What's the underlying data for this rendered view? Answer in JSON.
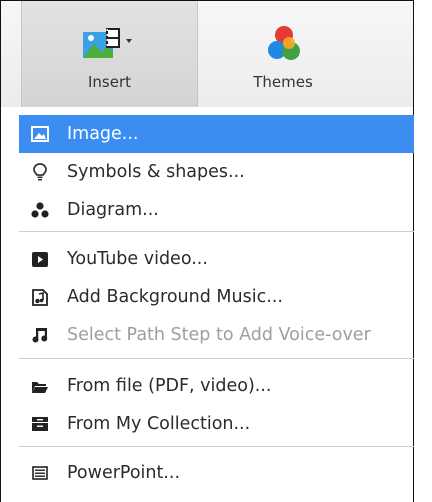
{
  "toolbar": {
    "insert_label": "Insert",
    "themes_label": "Themes"
  },
  "menu": {
    "items": [
      {
        "label": "Image...",
        "icon": "image-icon",
        "state": "highlighted"
      },
      {
        "label": "Symbols & shapes...",
        "icon": "lightbulb-icon",
        "state": "enabled"
      },
      {
        "label": "Diagram...",
        "icon": "diagram-icon",
        "state": "enabled"
      },
      {
        "label": "YouTube video...",
        "icon": "play-icon",
        "state": "enabled"
      },
      {
        "label": "Add Background Music...",
        "icon": "music-file-icon",
        "state": "enabled"
      },
      {
        "label": "Select Path Step to Add Voice-over",
        "icon": "music-note-icon",
        "state": "disabled"
      },
      {
        "label": "From file (PDF, video)...",
        "icon": "folder-icon",
        "state": "enabled"
      },
      {
        "label": "From My Collection...",
        "icon": "collection-icon",
        "state": "enabled"
      },
      {
        "label": "PowerPoint...",
        "icon": "powerpoint-icon",
        "state": "enabled"
      }
    ]
  },
  "colors": {
    "highlight": "#3b8df2",
    "text": "#2b2b2b",
    "disabled_text": "#9e9e9e",
    "separator": "#cfcfcf"
  }
}
